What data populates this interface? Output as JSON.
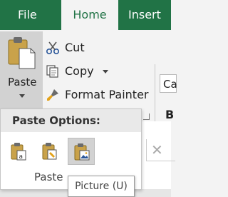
{
  "tabs": {
    "file": "File",
    "home": "Home",
    "insert": "Insert"
  },
  "clipboard": {
    "paste_label": "Paste",
    "cut_label": "Cut",
    "copy_label": "Copy",
    "format_painter_label": "Format Painter"
  },
  "font": {
    "name_partial": "Ca",
    "bold_label": "B"
  },
  "paste_menu": {
    "title": "Paste Options:",
    "footer": "Paste",
    "options": [
      {
        "icon": "paste-keep-source-icon"
      },
      {
        "icon": "paste-formatting-icon"
      },
      {
        "icon": "paste-picture-icon",
        "selected": true
      }
    ]
  },
  "tooltip": {
    "text": "Picture (U)"
  },
  "colors": {
    "brand_green": "#217346",
    "ribbon_bg": "#f3f3f3",
    "menu_header_bg": "#e9e9e9",
    "selected_option_bg": "#d2d2d2"
  }
}
